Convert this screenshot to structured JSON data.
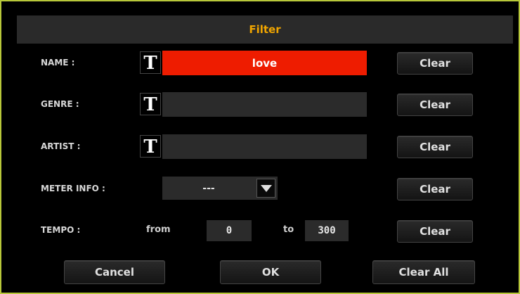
{
  "dialog": {
    "title": "Filter"
  },
  "fields": {
    "name": {
      "label": "NAME :",
      "value": "love",
      "clear": "Clear"
    },
    "genre": {
      "label": "GENRE :",
      "value": "",
      "clear": "Clear"
    },
    "artist": {
      "label": "ARTIST :",
      "value": "",
      "clear": "Clear"
    },
    "meter": {
      "label": "METER INFO :",
      "value": "---",
      "clear": "Clear"
    },
    "tempo": {
      "label": "TEMPO :",
      "from_label": "from",
      "from_value": "0",
      "to_label": "to",
      "to_value": "300",
      "clear": "Clear"
    }
  },
  "text_edit_icon": "T",
  "footer": {
    "cancel": "Cancel",
    "ok": "OK",
    "clear_all": "Clear All"
  },
  "colors": {
    "title": "#f0a500",
    "active_field": "#ee1c00",
    "frame_border": "#b8c83a"
  }
}
